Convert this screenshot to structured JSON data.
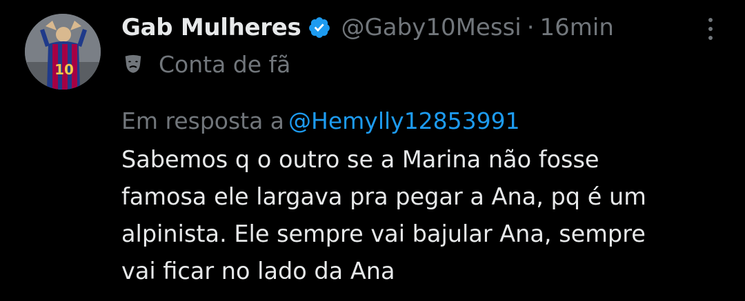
{
  "tweet": {
    "display_name": "Gab Mulheres",
    "handle": "@Gaby10Messi",
    "separator": "·",
    "time": "16min",
    "label": "Conta de fã",
    "reply_prefix": "Em resposta a",
    "reply_to": "@Hemylly12853991",
    "text_lines": [
      "Sabemos q o outro se a Marina não fosse",
      "famosa ele largava pra pegar a Ana, pq é um",
      "alpinista. Ele sempre vai bajular Ana, sempre",
      "vai ficar no lado da Ana"
    ]
  },
  "icons": {
    "verified": "verified-badge-icon",
    "label": "theater-mask-icon",
    "more": "more-options-icon"
  },
  "colors": {
    "background": "#000000",
    "primary_text": "#e7e9ea",
    "secondary_text": "#71767b",
    "link": "#1d9bf0",
    "verified": "#1d9bf0"
  }
}
